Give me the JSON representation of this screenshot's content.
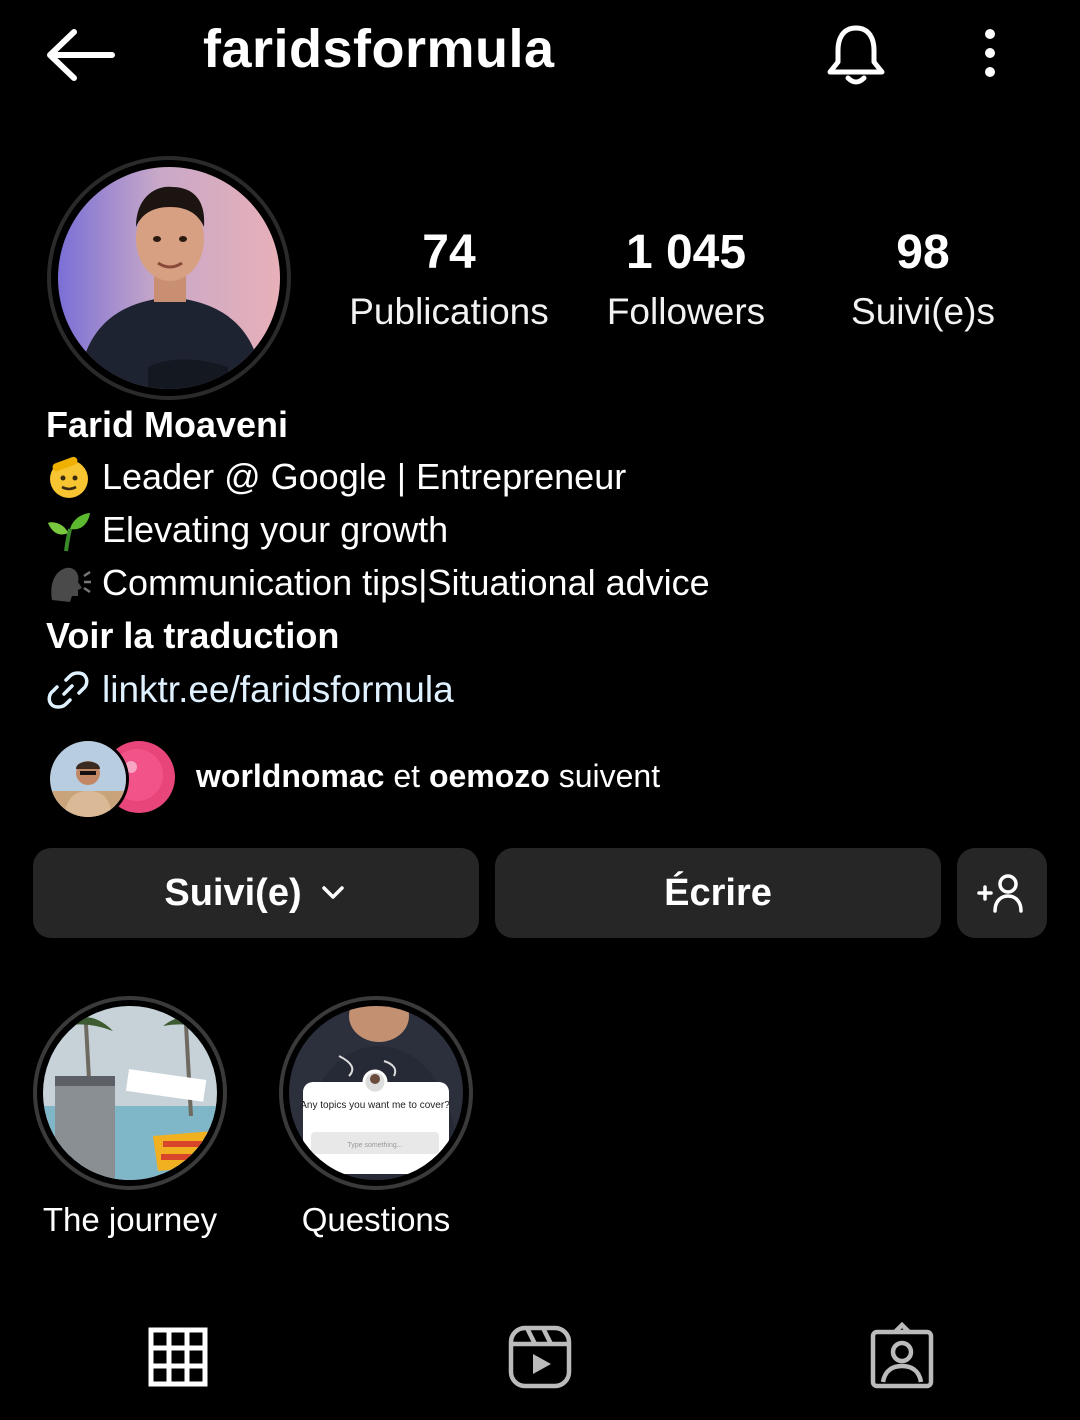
{
  "header": {
    "username": "faridsformula",
    "back_icon": "arrow-left-icon",
    "bell_icon": "bell-icon",
    "more_icon": "more-vertical-icon"
  },
  "profile": {
    "avatar_icon": "profile-photo"
  },
  "stats": [
    {
      "value": "74",
      "label": "Publications"
    },
    {
      "value": "1 045",
      "label": "Followers"
    },
    {
      "value": "98",
      "label": "Suivi(e)s"
    }
  ],
  "bio": {
    "name": "Farid Moaveni",
    "lines": [
      {
        "emoji": "saluting-face",
        "text": "Leader @ Google | Entrepreneur"
      },
      {
        "emoji": "seedling",
        "text": "Elevating your growth"
      },
      {
        "emoji": "speaking-head",
        "text": "Communication tips|Situational advice"
      }
    ],
    "translate": "Voir la traduction",
    "link": "linktr.ee/faridsformula",
    "link_color": "#e0f1ff"
  },
  "mutuals": {
    "user1": "worldnomac",
    "connector": " et ",
    "user2": "oemozo",
    "suffix": " suivent"
  },
  "buttons": {
    "follow": "Suivi(e)",
    "write": "Écrire",
    "add_icon": "add-person-icon"
  },
  "highlights": [
    {
      "label": "The journey"
    },
    {
      "label": "Questions",
      "card_title": "Any topics you want me to cover?",
      "card_placeholder": "Type something..."
    }
  ],
  "tabs": [
    {
      "icon": "grid-icon"
    },
    {
      "icon": "reels-icon"
    },
    {
      "icon": "tagged-icon"
    }
  ],
  "colors": {
    "background": "#000000",
    "button": "#262626",
    "link": "#e0f1ff"
  }
}
